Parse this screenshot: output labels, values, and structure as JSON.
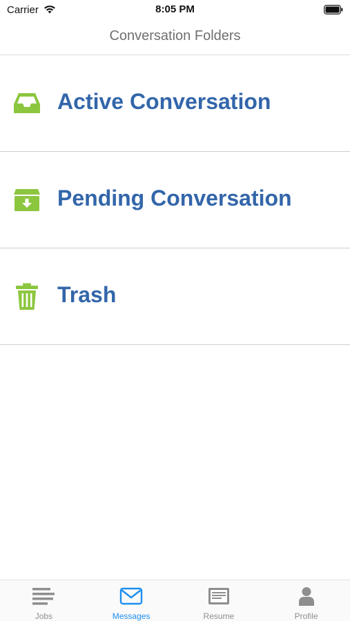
{
  "status_bar": {
    "carrier": "Carrier",
    "time": "8:05 PM"
  },
  "nav": {
    "title": "Conversation Folders"
  },
  "folders": [
    {
      "label": "Active Conversation",
      "icon": "inbox-icon"
    },
    {
      "label": "Pending Conversation",
      "icon": "archive-download-icon"
    },
    {
      "label": "Trash",
      "icon": "trash-icon"
    }
  ],
  "tabs": [
    {
      "label": "Jobs",
      "icon": "list-icon",
      "active": false
    },
    {
      "label": "Messages",
      "icon": "envelope-icon",
      "active": true
    },
    {
      "label": "Resume",
      "icon": "resume-icon",
      "active": false
    },
    {
      "label": "Profile",
      "icon": "person-icon",
      "active": false
    }
  ],
  "colors": {
    "accent_green": "#8cc63f",
    "label_blue": "#3366aa",
    "tab_active": "#1c8ef0",
    "tab_inactive": "#8e8e8e"
  }
}
